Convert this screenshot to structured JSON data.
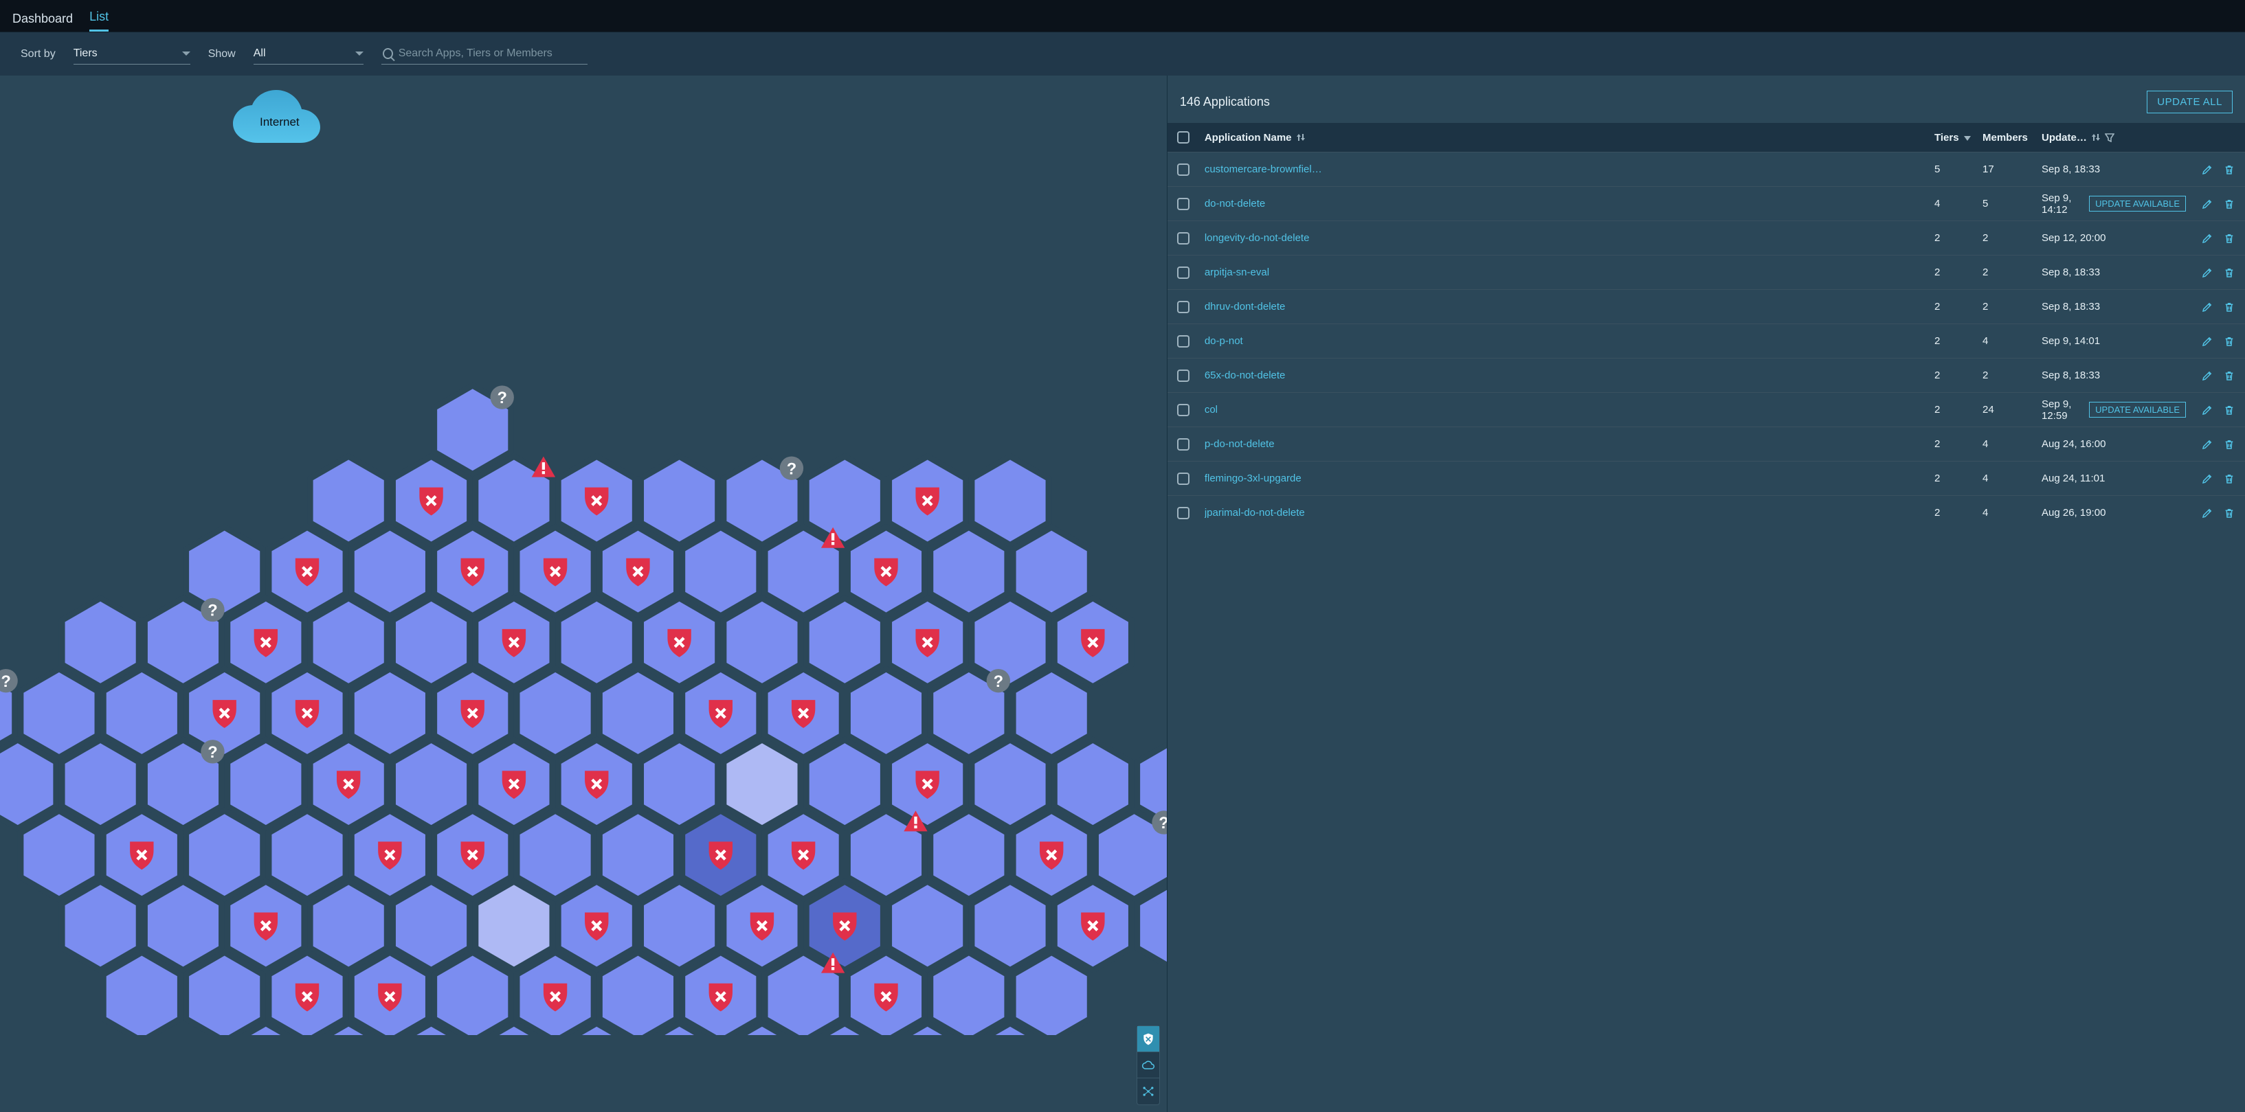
{
  "tabs": {
    "dashboard": "Dashboard",
    "list": "List"
  },
  "filters": {
    "sort_label": "Sort by",
    "sort_value": "Tiers",
    "show_label": "Show",
    "show_value": "All",
    "search_placeholder": "Search Apps, Tiers or Members"
  },
  "panel": {
    "count_text": "146 Applications",
    "update_all": "UPDATE ALL"
  },
  "columns": {
    "name": "Application Name",
    "tiers": "Tiers",
    "members": "Members",
    "updated": "Update…"
  },
  "badge_update": "UPDATE AVAILABLE",
  "viz": {
    "cloud_label": "Internet"
  },
  "rows": [
    {
      "name": "customercare-brownfiel…",
      "tiers": "5",
      "members": "17",
      "updated": "Sep 8, 18:33",
      "update": false
    },
    {
      "name": "do-not-delete",
      "tiers": "4",
      "members": "5",
      "updated": "Sep 9, 14:12",
      "update": true
    },
    {
      "name": "longevity-do-not-delete",
      "tiers": "2",
      "members": "2",
      "updated": "Sep 12, 20:00",
      "update": false
    },
    {
      "name": "arpitja-sn-eval",
      "tiers": "2",
      "members": "2",
      "updated": "Sep 8, 18:33",
      "update": false
    },
    {
      "name": "dhruv-dont-delete",
      "tiers": "2",
      "members": "2",
      "updated": "Sep 8, 18:33",
      "update": false
    },
    {
      "name": "do-p-not",
      "tiers": "2",
      "members": "4",
      "updated": "Sep 9, 14:01",
      "update": false
    },
    {
      "name": "65x-do-not-delete",
      "tiers": "2",
      "members": "2",
      "updated": "Sep 8, 18:33",
      "update": false
    },
    {
      "name": "col",
      "tiers": "2",
      "members": "24",
      "updated": "Sep 9, 12:59",
      "update": true
    },
    {
      "name": "p-do-not-delete",
      "tiers": "2",
      "members": "4",
      "updated": "Aug 24, 16:00",
      "update": false
    },
    {
      "name": "flemingo-3xl-upgarde",
      "tiers": "2",
      "members": "4",
      "updated": "Aug 24, 11:01",
      "update": false
    },
    {
      "name": "jparimal-do-not-delete",
      "tiers": "2",
      "members": "4",
      "updated": "Aug 26, 19:00",
      "update": false
    }
  ]
}
